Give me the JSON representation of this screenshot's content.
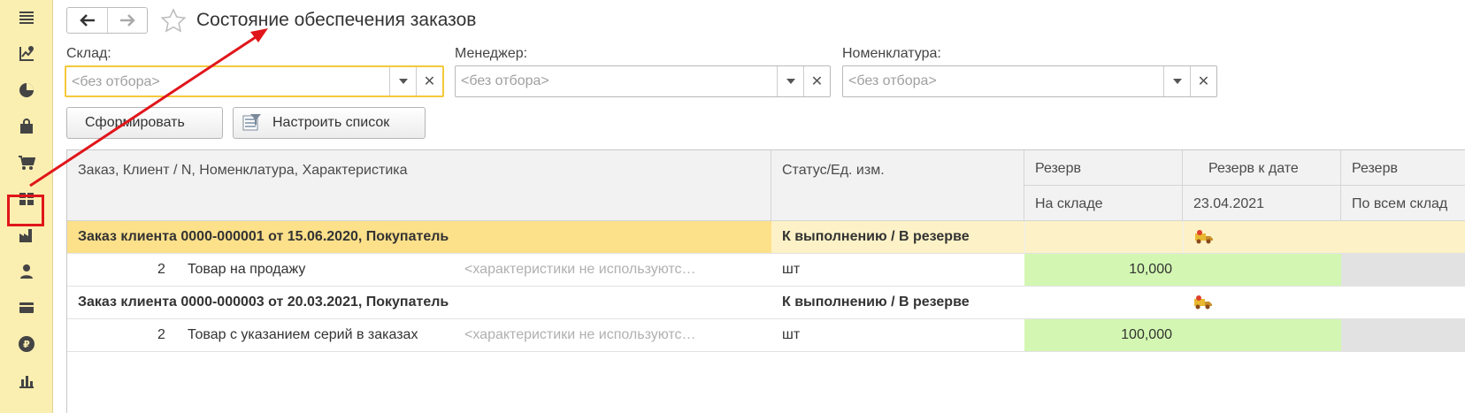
{
  "sidebar": {
    "items": [
      {
        "icon": "menu-icon"
      },
      {
        "icon": "stock-chart-icon"
      },
      {
        "icon": "pie-chart-icon"
      },
      {
        "icon": "shopping-bag-icon"
      },
      {
        "icon": "cart-icon"
      },
      {
        "icon": "warehouse-grid-icon",
        "active": true
      },
      {
        "icon": "factory-icon"
      },
      {
        "icon": "person-icon"
      },
      {
        "icon": "card-icon"
      },
      {
        "icon": "ruble-icon"
      },
      {
        "icon": "bar-chart-icon"
      }
    ]
  },
  "header": {
    "title": "Состояние обеспечения заказов"
  },
  "filters": {
    "warehouse": {
      "label": "Склад:",
      "placeholder": "<без отбора>"
    },
    "manager": {
      "label": "Менеджер:",
      "placeholder": "<без отбора>"
    },
    "nomenclature": {
      "label": "Номенклатура:",
      "placeholder": "<без отбора>"
    }
  },
  "toolbar": {
    "generate_label": "Сформировать",
    "configure_label": "Настроить список"
  },
  "table": {
    "headers": {
      "col1": "Заказ, Клиент / N, Номенклатура, Характеристика",
      "col2": "Статус/Ед. изм.",
      "col3_top": "Резерв",
      "col3_bottom": "На складе",
      "col4_top": "Резерв к дате",
      "col4_bottom": "23.04.2021",
      "col5_top": "Резерв",
      "col5_bottom": "По всем склад"
    },
    "rows": [
      {
        "type": "order",
        "title": "Заказ клиента 0000-000001 от 15.06.2020, Покупатель",
        "status": "К выполнению / В резерве"
      },
      {
        "type": "item",
        "num": "2",
        "name": "Товар на продажу",
        "characteristic": "<характеристики не используютс…",
        "unit": "шт",
        "reserve": "10,000"
      },
      {
        "type": "order",
        "title": "Заказ клиента 0000-000003 от 20.03.2021, Покупатель",
        "status": "К выполнению / В резерве"
      },
      {
        "type": "item",
        "num": "2",
        "name": "Товар с указанием серий в заказах",
        "characteristic": "<характеристики не используютс…",
        "unit": "шт",
        "reserve": "100,000"
      }
    ]
  },
  "colors": {
    "sidebar_bg": "#fbeeb1",
    "selected_row": "#fce08a",
    "selected_row_light": "#fdf2c7",
    "reserve_green": "#d3f7b2",
    "annotation_red": "#e0161b"
  }
}
